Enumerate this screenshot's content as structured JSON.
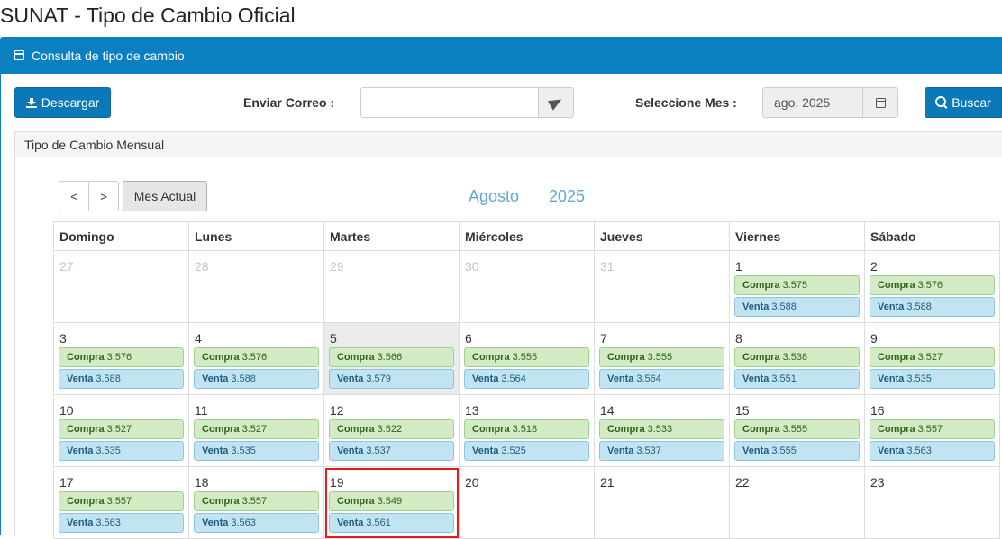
{
  "page": {
    "title": "SUNAT - Tipo de Cambio Oficial"
  },
  "panel": {
    "heading": "Consulta de tipo de cambio"
  },
  "toolbar": {
    "download_label": "Descargar",
    "email_label": "Enviar Correo :",
    "email_value": "",
    "month_label": "Seleccione Mes :",
    "month_value": "ago. 2025",
    "search_label": "Buscar"
  },
  "monthly": {
    "heading": "Tipo de Cambio Mensual"
  },
  "calendar": {
    "prev_label": "<",
    "next_label": ">",
    "today_label": "Mes Actual",
    "month_name": "Agosto",
    "year": "2025",
    "weekdays": [
      "Domingo",
      "Lunes",
      "Martes",
      "Miércoles",
      "Jueves",
      "Viernes",
      "Sábado"
    ],
    "buy_label": "Compra",
    "sell_label": "Venta",
    "weeks": [
      [
        {
          "day": "27",
          "other": true
        },
        {
          "day": "28",
          "other": true
        },
        {
          "day": "29",
          "other": true
        },
        {
          "day": "30",
          "other": true
        },
        {
          "day": "31",
          "other": true
        },
        {
          "day": "1",
          "buy": "3.575",
          "sell": "3.588"
        },
        {
          "day": "2",
          "buy": "3.576",
          "sell": "3.588"
        }
      ],
      [
        {
          "day": "3",
          "buy": "3.576",
          "sell": "3.588"
        },
        {
          "day": "4",
          "buy": "3.576",
          "sell": "3.588"
        },
        {
          "day": "5",
          "buy": "3.566",
          "sell": "3.579",
          "today": true
        },
        {
          "day": "6",
          "buy": "3.555",
          "sell": "3.564"
        },
        {
          "day": "7",
          "buy": "3.555",
          "sell": "3.564"
        },
        {
          "day": "8",
          "buy": "3.538",
          "sell": "3.551"
        },
        {
          "day": "9",
          "buy": "3.527",
          "sell": "3.535"
        }
      ],
      [
        {
          "day": "10",
          "buy": "3.527",
          "sell": "3.535"
        },
        {
          "day": "11",
          "buy": "3.527",
          "sell": "3.535"
        },
        {
          "day": "12",
          "buy": "3.522",
          "sell": "3.537"
        },
        {
          "day": "13",
          "buy": "3.518",
          "sell": "3.525"
        },
        {
          "day": "14",
          "buy": "3.533",
          "sell": "3.537"
        },
        {
          "day": "15",
          "buy": "3.555",
          "sell": "3.555"
        },
        {
          "day": "16",
          "buy": "3.557",
          "sell": "3.563"
        }
      ],
      [
        {
          "day": "17",
          "buy": "3.557",
          "sell": "3.563"
        },
        {
          "day": "18",
          "buy": "3.557",
          "sell": "3.563"
        },
        {
          "day": "19",
          "buy": "3.549",
          "sell": "3.561",
          "highlight": true
        },
        {
          "day": "20"
        },
        {
          "day": "21"
        },
        {
          "day": "22"
        },
        {
          "day": "23"
        }
      ]
    ]
  }
}
